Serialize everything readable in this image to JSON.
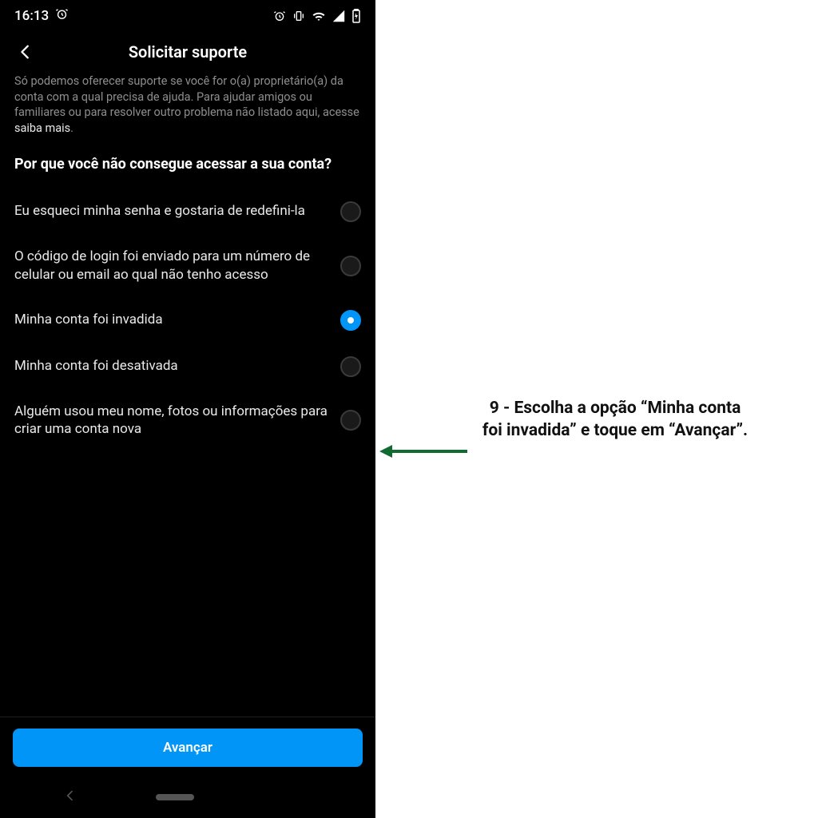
{
  "status": {
    "time": "16:13"
  },
  "header": {
    "title": "Solicitar suporte"
  },
  "description": {
    "text_prefix": "Só podemos oferecer suporte se você for o(a) proprietário(a) da conta com a qual precisa de ajuda. Para ajudar amigos ou familiares ou para resolver outro problema não listado aqui, acesse ",
    "link_text": "saiba mais",
    "text_suffix": "."
  },
  "question": "Por que você não consegue acessar a sua conta?",
  "options": [
    {
      "label": "Eu esqueci minha senha e gostaria de redefini-la",
      "selected": false
    },
    {
      "label": "O código de login foi enviado para um número de celular ou email ao qual não tenho acesso",
      "selected": false
    },
    {
      "label": "Minha conta foi invadida",
      "selected": true
    },
    {
      "label": "Minha conta foi desativada",
      "selected": false
    },
    {
      "label": "Alguém usou meu nome, fotos ou informações para criar uma conta nova",
      "selected": false
    }
  ],
  "primary_button": "Avançar",
  "annotation": "9 - Escolha a opção “Minha conta foi invadida” e toque em “Avançar”."
}
